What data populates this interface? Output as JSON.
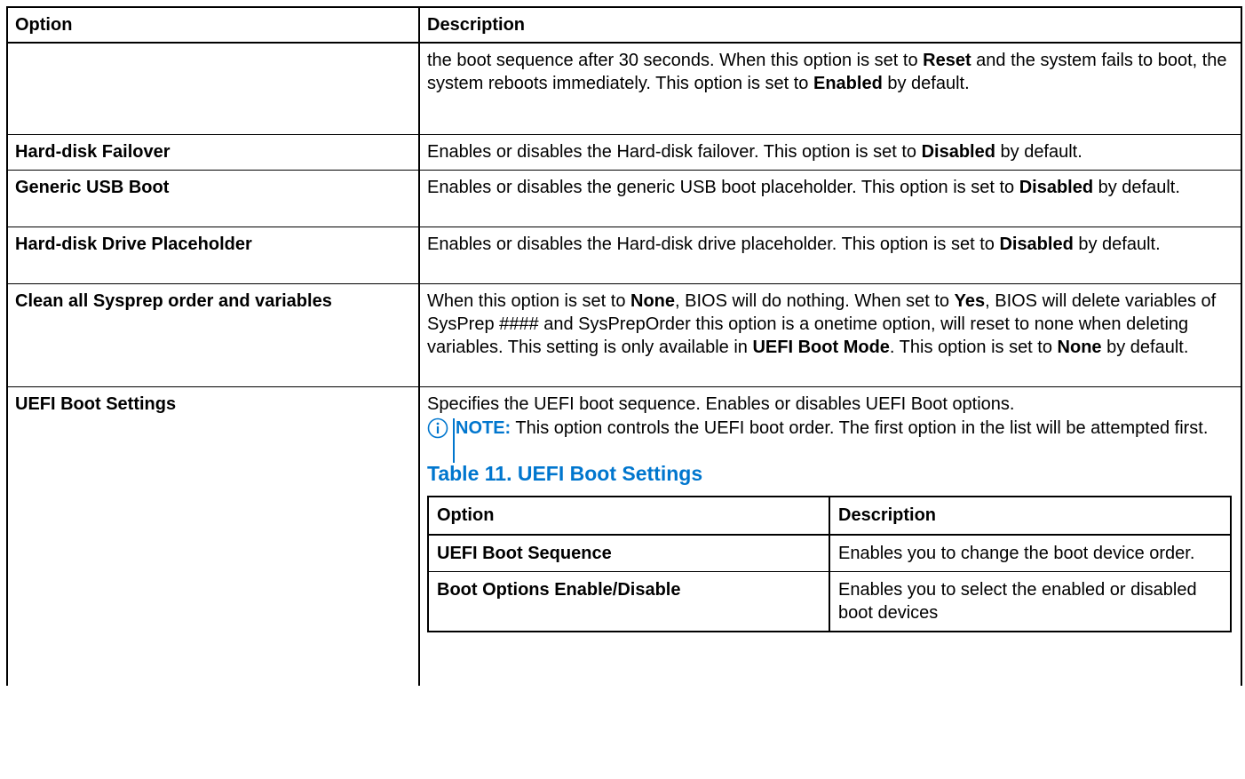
{
  "table": {
    "headers": {
      "option": "Option",
      "description": "Description"
    },
    "rows": [
      {
        "option": "",
        "desc": [
          "the boot sequence after 30 seconds. When this option is set to ",
          "Reset",
          " and the system fails to boot, the system reboots immediately. This option is set to ",
          "Enabled",
          " by default."
        ]
      },
      {
        "option": "Hard-disk Failover",
        "desc": [
          "Enables or disables the Hard-disk failover. This option is set to ",
          "Disabled",
          " by default."
        ]
      },
      {
        "option": "Generic USB Boot",
        "desc": [
          "Enables or disables the generic USB boot placeholder. This option is set to ",
          "Disabled",
          " by default."
        ]
      },
      {
        "option": "Hard-disk Drive Placeholder",
        "desc": [
          "Enables or disables the Hard-disk drive placeholder. This option is set to ",
          "Disabled",
          " by default."
        ]
      },
      {
        "option": "Clean all Sysprep order and variables",
        "desc": [
          "When this option is set to ",
          "None",
          ", BIOS will do nothing. When set to ",
          "Yes",
          ", BIOS will delete variables of SysPrep #### and SysPrepOrder this option is a onetime option, will reset to none when deleting variables. This setting is only available in ",
          "UEFI Boot Mode",
          ". This option is set to ",
          "None",
          " by default."
        ]
      },
      {
        "option": "UEFI Boot Settings",
        "desc_intro": "Specifies the UEFI boot sequence. Enables or disables UEFI Boot options.",
        "note_label": "NOTE:",
        "note_text": " This option controls the UEFI boot order. The first option in the list will be attempted first.",
        "inner_caption": "Table 11. UEFI Boot Settings",
        "inner_headers": {
          "option": "Option",
          "description": "Description"
        },
        "inner_rows": [
          {
            "option": "UEFI Boot Sequence",
            "description": "Enables you to change the boot device order."
          },
          {
            "option": "Boot Options Enable/Disable",
            "description": "Enables you to select the enabled or disabled boot devices"
          }
        ]
      }
    ]
  },
  "colors": {
    "accent": "#0076ce",
    "text": "#000000"
  },
  "icons": {
    "note": "info-circle-icon"
  }
}
